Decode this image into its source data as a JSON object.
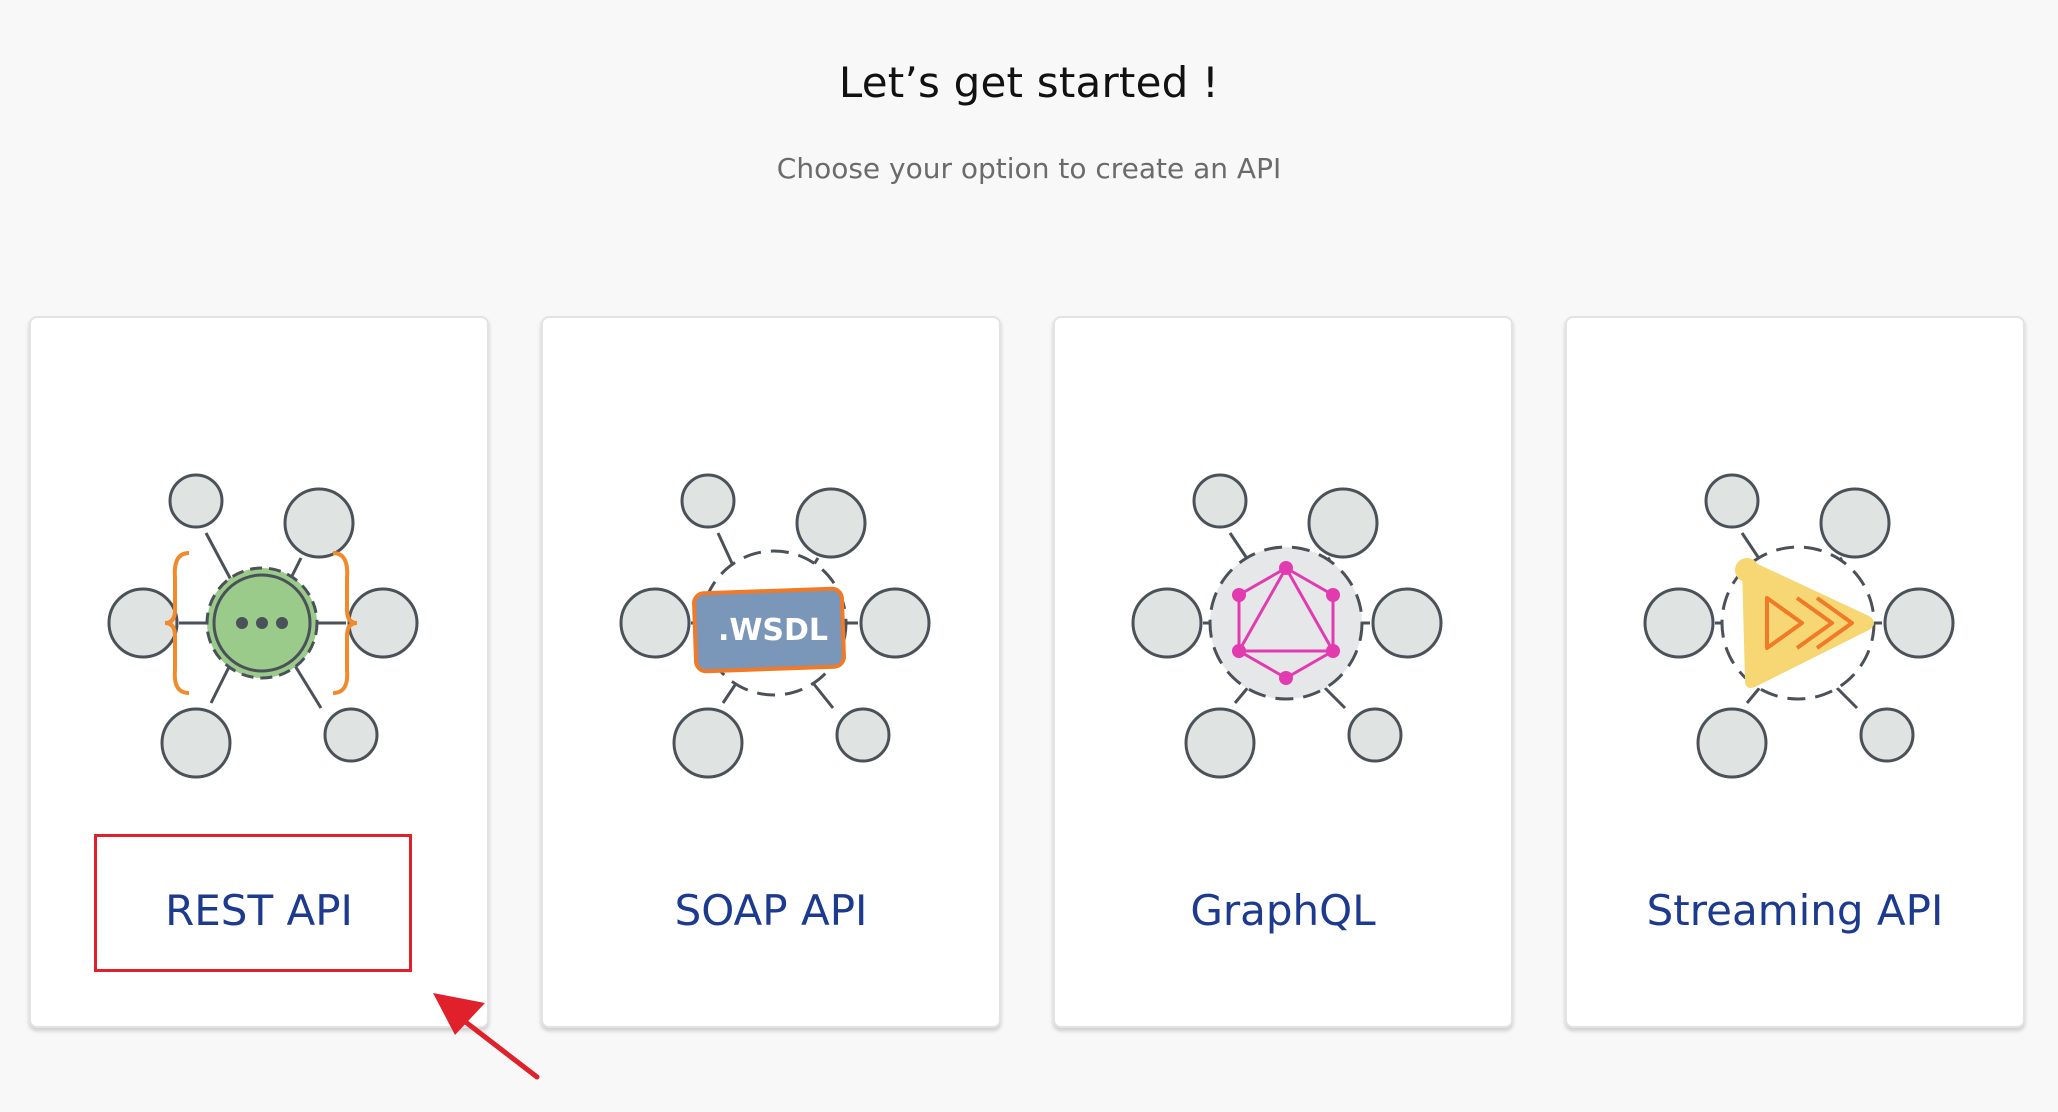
{
  "header": {
    "title": "Let’s get started !",
    "subtitle": "Choose your option to create an API"
  },
  "cards": [
    {
      "label": "REST API",
      "icon": "rest-api-icon",
      "badge_text": ""
    },
    {
      "label": "SOAP API",
      "icon": "soap-wsdl-icon",
      "badge_text": ".WSDL"
    },
    {
      "label": "GraphQL",
      "icon": "graphql-icon",
      "badge_text": ""
    },
    {
      "label": "Streaming API",
      "icon": "streaming-icon",
      "badge_text": ""
    }
  ],
  "annotations": {
    "highlight_color": "#e0202a",
    "arrow_color": "#e0202a"
  },
  "colors": {
    "label_blue": "#1c3a8e",
    "node_fill": "#dfe3e1",
    "node_stroke": "#4a5158",
    "rest_gear": "#9acb8a",
    "rest_brace": "#f08a2a",
    "wsdl_badge": "#7a96b8",
    "wsdl_border": "#f07a28",
    "graphql_pink": "#e23bb0",
    "streaming_yellow": "#f7d774",
    "streaming_orange": "#f07a28"
  }
}
